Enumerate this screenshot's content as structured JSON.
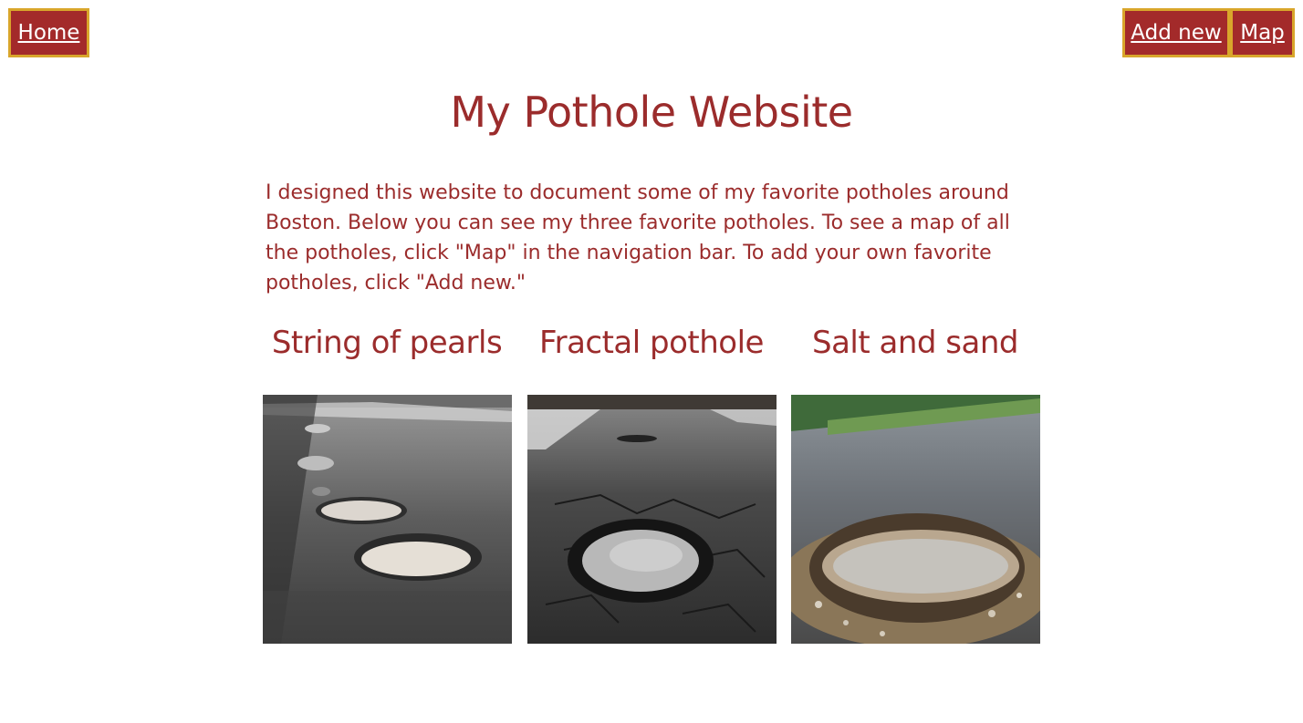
{
  "nav": {
    "home_label": "Home",
    "add_new_label": "Add new",
    "map_label": "Map"
  },
  "page": {
    "title": "My Pothole Website",
    "intro": "I designed this website to document some of my favorite potholes around Boston. Below you can see my three favorite potholes. To see a map of all the potholes, click \"Map\" in the navigation bar. To add your own favorite potholes, click \"Add new.\""
  },
  "potholes": [
    {
      "title": "String of pearls",
      "image": "pothole-photo-string-of-pearls"
    },
    {
      "title": "Fractal pothole",
      "image": "pothole-photo-fractal"
    },
    {
      "title": "Salt and sand",
      "image": "pothole-photo-salt-and-sand"
    }
  ],
  "colors": {
    "accent": "#a32a2a",
    "nav_border": "#d9a62b",
    "text": "#9b2c2c"
  }
}
